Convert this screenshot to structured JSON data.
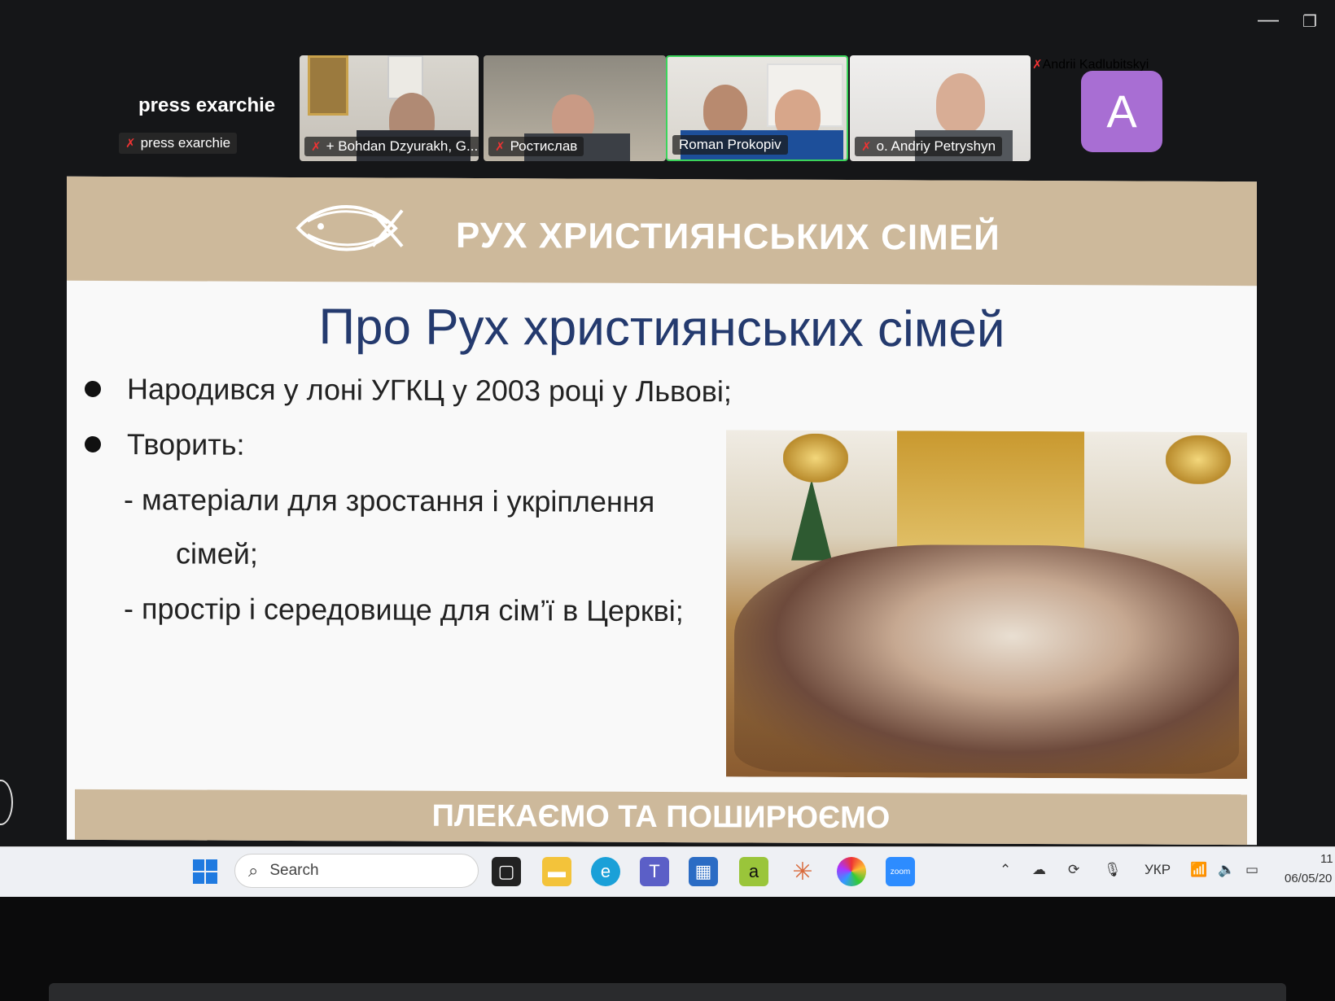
{
  "zoom": {
    "self": {
      "name": "press exarchie",
      "tag": "press exarchie"
    },
    "participants": [
      {
        "name": "+ Bohdan Dzyurakh, G...",
        "muted": true
      },
      {
        "name": "Ростислав",
        "muted": true
      },
      {
        "name": "Roman Prokopiv",
        "muted": false,
        "active": true
      },
      {
        "name": "o. Andriy Petryshyn",
        "muted": true
      },
      {
        "name": "Andrii Kadlubitskyi",
        "muted": true,
        "avatar_letter": "A"
      }
    ]
  },
  "slide": {
    "header_title": "РУХ ХРИСТИЯНСЬКИХ СІМЕЙ",
    "logo_text": "РУХ ХРИСТИЯНСЬКИХ СІМЕЙ",
    "title": "Про Рух християнських сімей",
    "bullet1": "Народився у лоні УГКЦ у 2003 році у Львові;",
    "bullet2": "Творить:",
    "sub1_line1": "- матеріали для зростання і укріплення",
    "sub1_line2": "сімей;",
    "sub2": "- простір і середовище для сім’ї в Церкві;",
    "footer": "ПЛЕКАЄМО ТА ПОШИРЮЄМО"
  },
  "taskbar": {
    "search_placeholder": "Search",
    "language": "УКР",
    "time": "11",
    "date": "06/05/20"
  },
  "icons": [
    "windows-start-icon",
    "search-icon",
    "task-view-icon",
    "file-explorer-icon",
    "edge-icon",
    "teams-icon",
    "store-icon",
    "app-a-icon",
    "claude-icon",
    "chrome-colors-icon",
    "zoom-icon",
    "chevron-up-icon",
    "onedrive-icon",
    "sync-icon",
    "mic-icon",
    "wifi-icon",
    "speaker-icon",
    "battery-icon"
  ]
}
